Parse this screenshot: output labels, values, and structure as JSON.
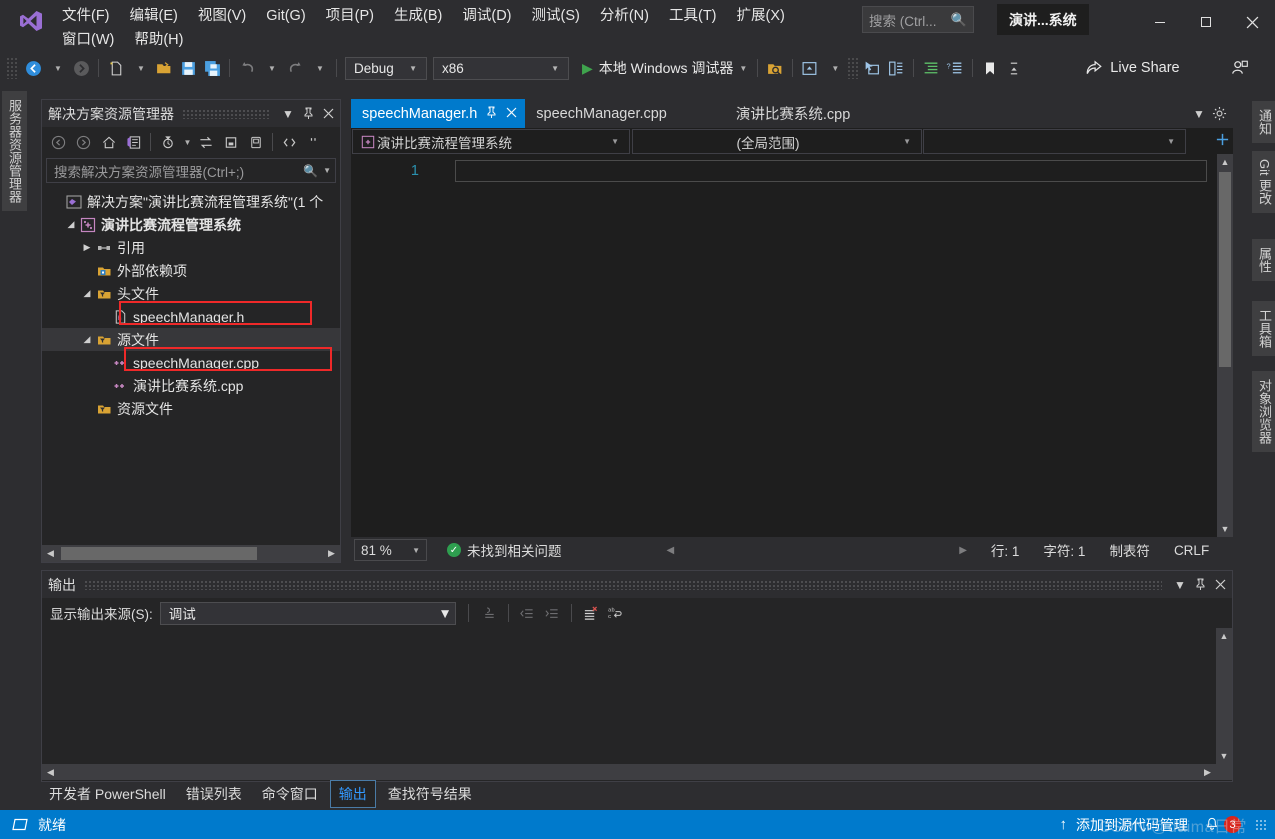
{
  "app": {
    "project_badge": "演讲...系统",
    "accent": "#007acc",
    "highlight_red": "#ef2929"
  },
  "menu": {
    "row1": [
      {
        "label": "文件(F)",
        "key": "F"
      },
      {
        "label": "编辑(E)",
        "key": "E"
      },
      {
        "label": "视图(V)",
        "key": "V"
      },
      {
        "label": "Git(G)",
        "key": "G"
      },
      {
        "label": "项目(P)",
        "key": "P"
      },
      {
        "label": "生成(B)",
        "key": "B"
      },
      {
        "label": "调试(D)",
        "key": "D"
      },
      {
        "label": "测试(S)",
        "key": "S"
      },
      {
        "label": "分析(N)",
        "key": "N"
      },
      {
        "label": "工具(T)",
        "key": "T"
      },
      {
        "label": "扩展(X)",
        "key": "X"
      }
    ],
    "row2": [
      {
        "label": "窗口(W)",
        "key": "W"
      },
      {
        "label": "帮助(H)",
        "key": "H"
      }
    ]
  },
  "search": {
    "placeholder": "搜索 (Ctrl...",
    "icon": "search-icon"
  },
  "window_controls": {
    "minimize": "—",
    "maximize": "☐",
    "close": "✕"
  },
  "toolbar": {
    "config": "Debug",
    "platform": "x86",
    "run_label": "本地 Windows 调试器",
    "live_share": "Live Share",
    "icons": [
      "navigate-back-icon",
      "navigate-forward-icon",
      "new-file-icon",
      "open-file-icon",
      "save-icon",
      "save-all-icon",
      "undo-icon",
      "redo-icon",
      "start-icon",
      "find-in-files-icon",
      "preview-icon",
      "select-element-icon",
      "copy-frame-icon",
      "indent-icon",
      "outline-icon",
      "bookmark-icon",
      "live-share-icon",
      "share-profile-icon"
    ]
  },
  "left_dock": {
    "tabs": [
      "服务器资源管理器"
    ]
  },
  "right_dock": {
    "tabs": [
      "通知",
      "Git 更改",
      "属性",
      "工具箱",
      "对象浏览器"
    ]
  },
  "solution_explorer": {
    "title": "解决方案资源管理器",
    "header_buttons": [
      "chevron-down-icon",
      "pin-icon",
      "close-icon"
    ],
    "toolbar_icons": [
      "back-icon",
      "forward-icon",
      "home-icon",
      "pending-changes-icon",
      "filter-icon",
      "sync-icon",
      "collapse-all-icon",
      "properties-icon",
      "show-all-files-icon",
      "preview-icon"
    ],
    "search_placeholder": "搜索解决方案资源管理器(Ctrl+;)",
    "tree": [
      {
        "label": "解决方案\"演讲比赛流程管理系统\"(1 个",
        "indent": 0,
        "icon": "solution-icon",
        "expander": "",
        "selected": false,
        "highlighted": false
      },
      {
        "label": "演讲比赛流程管理系统",
        "indent": 1,
        "icon": "cpp-project-icon",
        "expander": "▲",
        "selected": false,
        "highlighted": false,
        "bold": true
      },
      {
        "label": "引用",
        "indent": 2,
        "icon": "references-icon",
        "expander": "▶",
        "selected": false,
        "highlighted": false
      },
      {
        "label": "外部依赖项",
        "indent": 2,
        "icon": "external-deps-icon",
        "expander": "",
        "selected": false,
        "highlighted": false
      },
      {
        "label": "头文件",
        "indent": 2,
        "icon": "folder-filter-icon",
        "expander": "▲",
        "selected": false,
        "highlighted": false
      },
      {
        "label": "speechManager.h",
        "indent": 3,
        "icon": "header-file-icon",
        "expander": "",
        "selected": false,
        "highlighted": true
      },
      {
        "label": "源文件",
        "indent": 2,
        "icon": "folder-filter-icon",
        "expander": "▲",
        "selected": true,
        "highlighted": false
      },
      {
        "label": "speechManager.cpp",
        "indent": 3,
        "icon": "cpp-file-icon",
        "expander": "",
        "selected": false,
        "highlighted": true
      },
      {
        "label": "演讲比赛系统.cpp",
        "indent": 3,
        "icon": "cpp-file-icon",
        "expander": "",
        "selected": false,
        "highlighted": false
      },
      {
        "label": "资源文件",
        "indent": 2,
        "icon": "folder-filter-icon",
        "expander": "",
        "selected": false,
        "highlighted": false
      }
    ]
  },
  "editor": {
    "tabs": [
      {
        "label": "speechManager.h",
        "active": true
      },
      {
        "label": "speechManager.cpp",
        "active": false
      },
      {
        "label": "演讲比赛系统.cpp",
        "active": false
      }
    ],
    "nav_project": "演讲比赛流程管理系统",
    "nav_scope": "(全局范围)",
    "nav_member": "",
    "line_number": "1",
    "status": {
      "zoom": "81 %",
      "issues": "未找到相关问题",
      "line": "行: 1",
      "char": "字符: 1",
      "tabs_mode": "制表符",
      "eol": "CRLF"
    }
  },
  "output": {
    "title": "输出",
    "header_buttons": [
      "chevron-down-icon",
      "pin-icon",
      "close-icon"
    ],
    "source_label": "显示输出来源(S):",
    "source_value": "调试",
    "toolbar_icons": [
      "find-message-icon",
      "go-to-previous-icon",
      "go-to-next-icon",
      "clear-all-icon",
      "toggle-word-wrap-icon"
    ],
    "content": ""
  },
  "bottom_tabs": [
    {
      "label": "开发者 PowerShell",
      "active": false
    },
    {
      "label": "错误列表",
      "active": false
    },
    {
      "label": "命令窗口",
      "active": false
    },
    {
      "label": "输出",
      "active": true
    },
    {
      "label": "查找符号结果",
      "active": false
    }
  ],
  "status_bar": {
    "state": "就绪",
    "source_control": "添加到源代码管理",
    "notification_count": "3",
    "watermark": "CSDN @daima日常"
  }
}
